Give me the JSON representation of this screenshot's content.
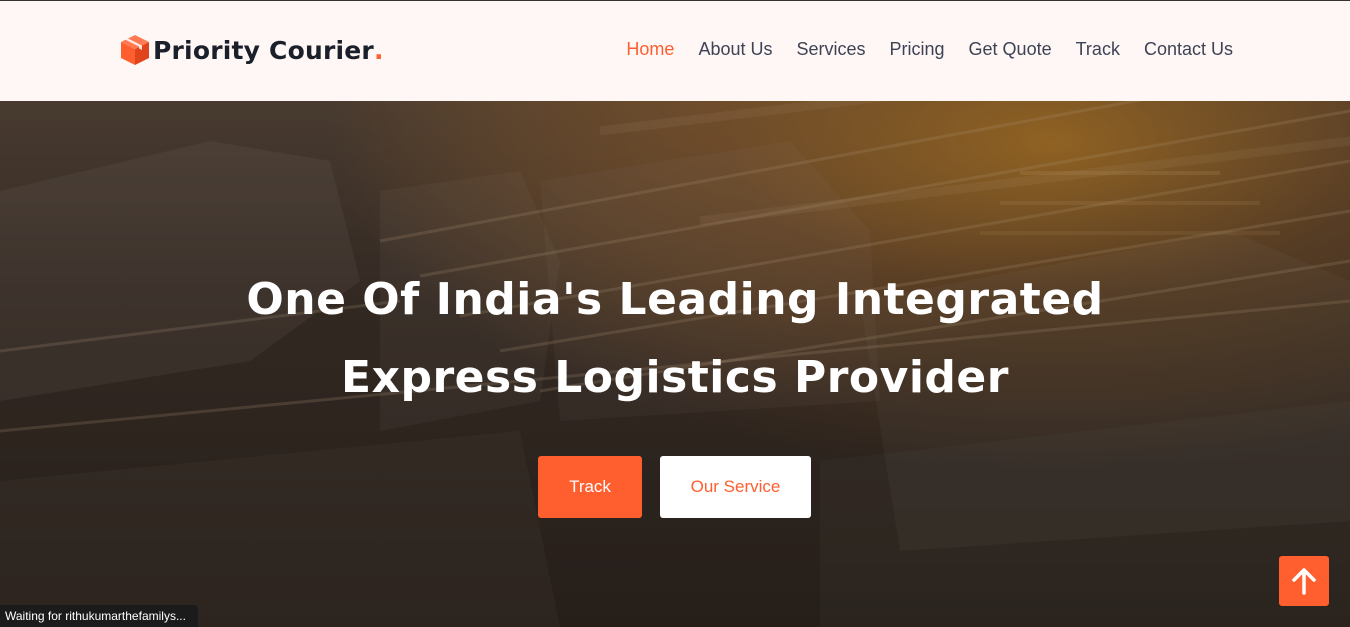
{
  "brand": {
    "name": "Priority Courier",
    "dot": ".",
    "icon": "package-box-icon",
    "accent": "#ff5e2e"
  },
  "nav": {
    "items": [
      {
        "label": "Home",
        "active": true
      },
      {
        "label": "About Us"
      },
      {
        "label": "Services"
      },
      {
        "label": "Pricing"
      },
      {
        "label": "Get Quote"
      },
      {
        "label": "Track"
      },
      {
        "label": "Contact Us"
      }
    ]
  },
  "hero": {
    "line1": "One Of India's Leading Integrated",
    "line2": "Express Logistics Provider",
    "track_label": "Track",
    "service_label": "Our Service"
  },
  "back_to_top": {
    "icon": "arrow-up-icon"
  },
  "status_bar": {
    "text": "Waiting for rithukumarthefamilys..."
  }
}
